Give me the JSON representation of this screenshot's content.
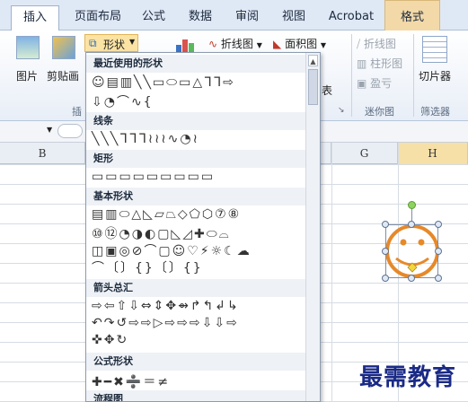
{
  "tabs": [
    {
      "label": "插入",
      "active": true
    },
    {
      "label": "页面布局"
    },
    {
      "label": "公式"
    },
    {
      "label": "数据"
    },
    {
      "label": "审阅"
    },
    {
      "label": "视图"
    },
    {
      "label": "Acrobat"
    },
    {
      "label": "格式",
      "contextual": true
    }
  ],
  "ribbon": {
    "picture_label": "图片",
    "clipart_label": "剪贴画",
    "shapes_label": "形状",
    "group_insert_label": "插",
    "line_chart_label": "折线图",
    "area_chart_label": "面积图",
    "chart_tail": "表",
    "spark_line": "折线图",
    "spark_column": "柱形图",
    "spark_winloss": "盈亏",
    "sparkline_group": "迷你图",
    "slicer_label": "切片器",
    "filter_group": "筛选器"
  },
  "columns": [
    "B",
    "G",
    "H"
  ],
  "dropdown": {
    "sections": [
      {
        "title": "最近使用的形状",
        "rows": [
          "☺▤▥╲╲▭⬭▭△ᒣᒣ⇨",
          "⇩◔⌒∿{"
        ]
      },
      {
        "title": "线条",
        "rows": [
          "╲╲╲ᒣᒣᒣ≀≀≀∿◔≀"
        ]
      },
      {
        "title": "矩形",
        "rows": [
          "▭▭▭▭▭▭▭▭▭"
        ]
      },
      {
        "title": "基本形状",
        "rows": [
          "▤▥⬭△◺▱⏢◇⬠⬡⑦⑧",
          "⑩⑫◔◑◐▢◺◿✚⬭⌓",
          "◫▣◎⊘⌒▢☺♡⚡☼☾☁",
          "⌒〔〕{}〔〕{}"
        ]
      },
      {
        "title": "箭头总汇",
        "rows": [
          "⇨⇦⇧⇩⇔⇕✥⇴↱↰↲↳",
          "↶↷↺⇨⇨▷⇨⇨⇨⇩⇩⇨",
          "✜✥↻"
        ]
      },
      {
        "title": "公式形状",
        "rows": [
          "✚━✖➗＝≠"
        ]
      },
      {
        "title": "流程图",
        "rows": []
      }
    ]
  },
  "watermark": "最需教育",
  "colors": {
    "accent": "#e38a2a",
    "smiley": "#e6892a",
    "handle_rotate": "#8ed35f"
  }
}
